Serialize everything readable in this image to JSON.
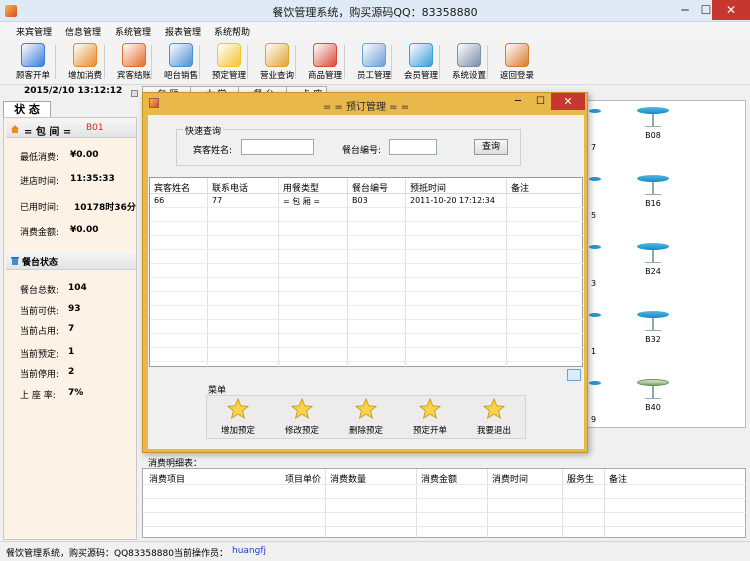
{
  "window": {
    "title": "餐饮管理系统，购买源码QQ：83358880",
    "min": "─",
    "max": "☐",
    "close": "✕"
  },
  "menubar": [
    "来宾管理",
    "信息管理",
    "系统管理",
    "报表管理",
    "系统帮助"
  ],
  "toolbar": [
    {
      "label": "顾客开单",
      "icon": "pencil-icon",
      "color": "#3a7cd8"
    },
    {
      "label": "增加消费",
      "icon": "arrow-icon",
      "color": "#e98a2a"
    },
    {
      "label": "宾客结账",
      "icon": "arrow-icon",
      "color": "#e76b2a"
    },
    {
      "label": "吧台销售",
      "icon": "blocks-icon",
      "color": "#4a8fd6"
    },
    {
      "label": "预定管理",
      "icon": "star-icon",
      "color": "#f2c531"
    },
    {
      "label": "营业查询",
      "icon": "magnifier-icon",
      "color": "#e1a42e"
    },
    {
      "label": "商品管理",
      "icon": "gear-icon",
      "color": "#d94b3a"
    },
    {
      "label": "员工管理",
      "icon": "id-card-icon",
      "color": "#6aa0d6"
    },
    {
      "label": "会员管理",
      "icon": "card-icon",
      "color": "#3a9ed8"
    },
    {
      "label": "系统设置",
      "icon": "tools-icon",
      "color": "#7a8ea8"
    },
    {
      "label": "返回登录",
      "icon": "exit-icon",
      "color": "#d87a2a"
    }
  ],
  "date": "2015/2/10  13:12:12",
  "status_tab": "状  态",
  "room": {
    "label": "= 包  间 =",
    "value": "B01"
  },
  "room_info": [
    {
      "label": "最低消费:",
      "value": "¥0.00"
    },
    {
      "label": "进店时间:",
      "value": "11:35:33"
    },
    {
      "label": "已用时间:",
      "value": "10178时36分"
    },
    {
      "label": "消费金额:",
      "value": "¥0.00"
    }
  ],
  "table_status_title": "餐台状态",
  "table_status": [
    {
      "label": "餐台总数:",
      "value": "104"
    },
    {
      "label": "当前可供:",
      "value": "93"
    },
    {
      "label": "当前占用:",
      "value": "7"
    },
    {
      "label": "当前预定:",
      "value": "1"
    },
    {
      "label": "当前停用:",
      "value": "2"
    },
    {
      "label": "上 座 率:",
      "value": "7%"
    }
  ],
  "area_tabs": [
    "= 包  厢 =",
    "= 大  堂 =",
    "= 餐  台 =",
    "= 卡  座"
  ],
  "stools": [
    {
      "name": "B08",
      "state": "free"
    },
    {
      "name": "B16",
      "state": "free"
    },
    {
      "name": "B24",
      "state": "free"
    },
    {
      "name": "B32",
      "state": "free"
    },
    {
      "name": "B40",
      "state": "occupied"
    }
  ],
  "partial_numbers": [
    "7",
    "5",
    "3",
    "1",
    "9"
  ],
  "dialog": {
    "title": "= = 预订管理 = =",
    "min": "─",
    "max": "☐",
    "close": "✕",
    "quick_query": "快速查询",
    "guest_name_label": "宾客姓名:",
    "table_no_label": "餐台编号:",
    "query_button": "查询",
    "columns": [
      "宾客姓名",
      "联系电话",
      "用餐类型",
      "餐台编号",
      "预抵时间",
      "备注"
    ],
    "rows": [
      [
        "66",
        "77",
        "= 包  厢 =",
        "B03",
        "2011-10-20 17:12:34",
        ""
      ]
    ],
    "menu_label": "菜单",
    "menu_buttons": [
      "增加预定",
      "修改预定",
      "删除预定",
      "预定开单",
      "我要退出"
    ]
  },
  "detail": {
    "label": "消费明细表：",
    "columns": [
      "消费项目",
      "项目单价",
      "消费数量",
      "消费金额",
      "消费时间",
      "服务生",
      "备注"
    ]
  },
  "statusbar": {
    "text": "餐饮管理系统，购买源码：QQ83358880",
    "operator_label": "当前操作员：",
    "operator": "huangfj"
  }
}
